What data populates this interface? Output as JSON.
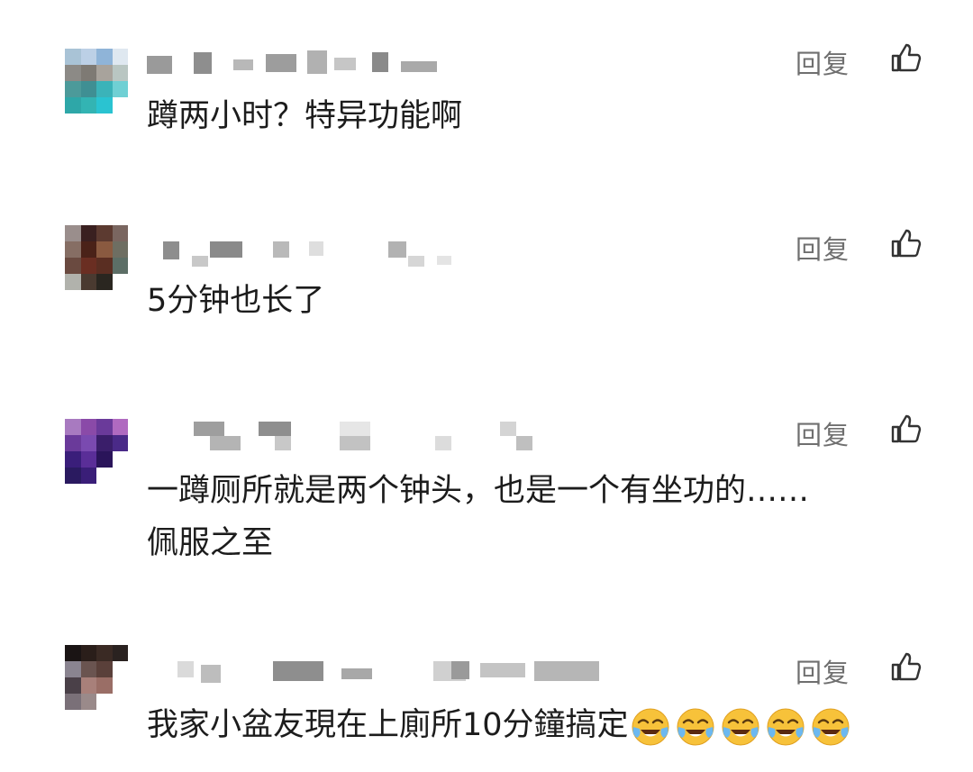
{
  "comments": [
    {
      "reply_label": "回复",
      "text": "蹲两小时？特异功能啊",
      "emoji_count": 0
    },
    {
      "reply_label": "回复",
      "text": "5分钟也长了",
      "emoji_count": 0
    },
    {
      "reply_label": "回复",
      "text": "一蹲厕所就是两个钟头，也是一个有坐功的……\n佩服之至",
      "emoji_count": 0
    },
    {
      "reply_label": "回复",
      "text": "我家小盆友現在上廁所10分鐘搞定",
      "emoji_count": 5,
      "emoji": "laughing-crying-emoji"
    }
  ],
  "icons": {
    "like": "thumbs-up-icon"
  },
  "colors": {
    "reply_text": "#6f6f6f",
    "body_text": "#1c1c1c",
    "emoji_face": "#f7c23a"
  }
}
